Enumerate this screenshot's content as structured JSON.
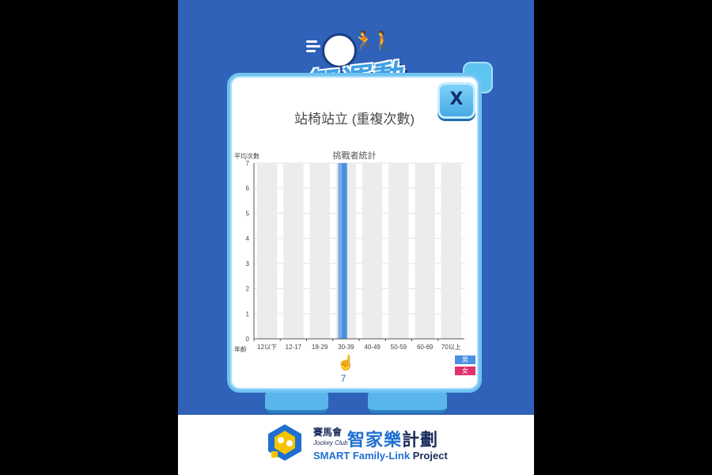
{
  "app": {
    "logo_text": "智運動"
  },
  "modal": {
    "title": "站椅站立 (重複次數)",
    "close_label": "X"
  },
  "chart_data": {
    "type": "bar",
    "title": "挑戰者統計",
    "ylabel": "平均次數",
    "xlabel": "年齡",
    "categories": [
      "12以下",
      "12-17",
      "18-29",
      "30-39",
      "40-49",
      "50-59",
      "60-69",
      "70以上"
    ],
    "series": [
      {
        "name": "男",
        "values": [
          0,
          0,
          0,
          7,
          0,
          0,
          0,
          0
        ],
        "color": "#4a90e2"
      },
      {
        "name": "女",
        "values": [
          0,
          0,
          0,
          0,
          0,
          0,
          0,
          0
        ],
        "color": "#e0326e"
      }
    ],
    "ylim": [
      0,
      7
    ],
    "yticks": [
      "0",
      "1",
      "2",
      "3",
      "4",
      "5",
      "6",
      "7"
    ],
    "grid": true,
    "background_band_color": "#ececec",
    "legend_placement": "bottom-right",
    "selected_category": "30-39",
    "selected_value": "7"
  },
  "footer": {
    "brand_zh_small_1": "賽馬會",
    "brand_jc": "Jockey Club",
    "brand_zh_big_1": "智家樂",
    "brand_zh_big_2": "計劃",
    "brand_en_1": "SMART Family-Link",
    "brand_en_2": "Project"
  }
}
